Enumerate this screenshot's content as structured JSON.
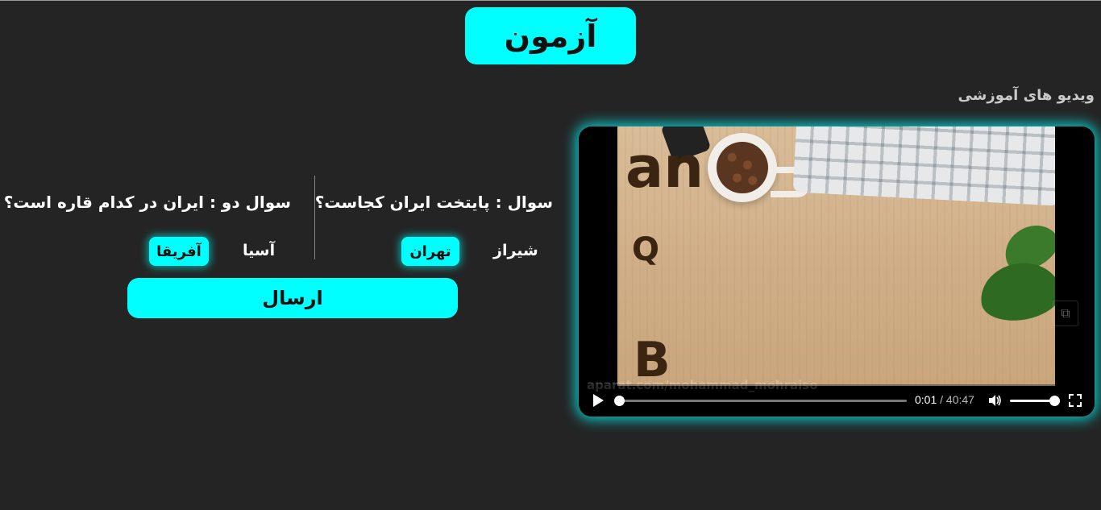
{
  "header": {
    "title": "آزمون"
  },
  "sidebar": {
    "section_label": "ویدیو های آموزشی"
  },
  "video": {
    "current_time": "0:01",
    "duration": "40:47",
    "progress": 0.0004,
    "volume": 1.0,
    "watermark": "aparat.com/mohammad_mohraiso",
    "icons": [
      "play-icon",
      "volume-icon",
      "fullscreen-icon",
      "picture-in-picture-icon"
    ]
  },
  "quiz": {
    "question1": {
      "text": "سوال : پایتخت ایران کجاست؟",
      "options": [
        "شیراز",
        "تهران"
      ],
      "selected": "تهران"
    },
    "question2": {
      "text": "سوال دو : ایران در کدام قاره است؟",
      "options": [
        "آسیا",
        "آفریقا"
      ],
      "selected": "آفریقا"
    },
    "submit_label": "ارسال"
  },
  "colors": {
    "accent": "#00ffff",
    "background": "#242424"
  }
}
